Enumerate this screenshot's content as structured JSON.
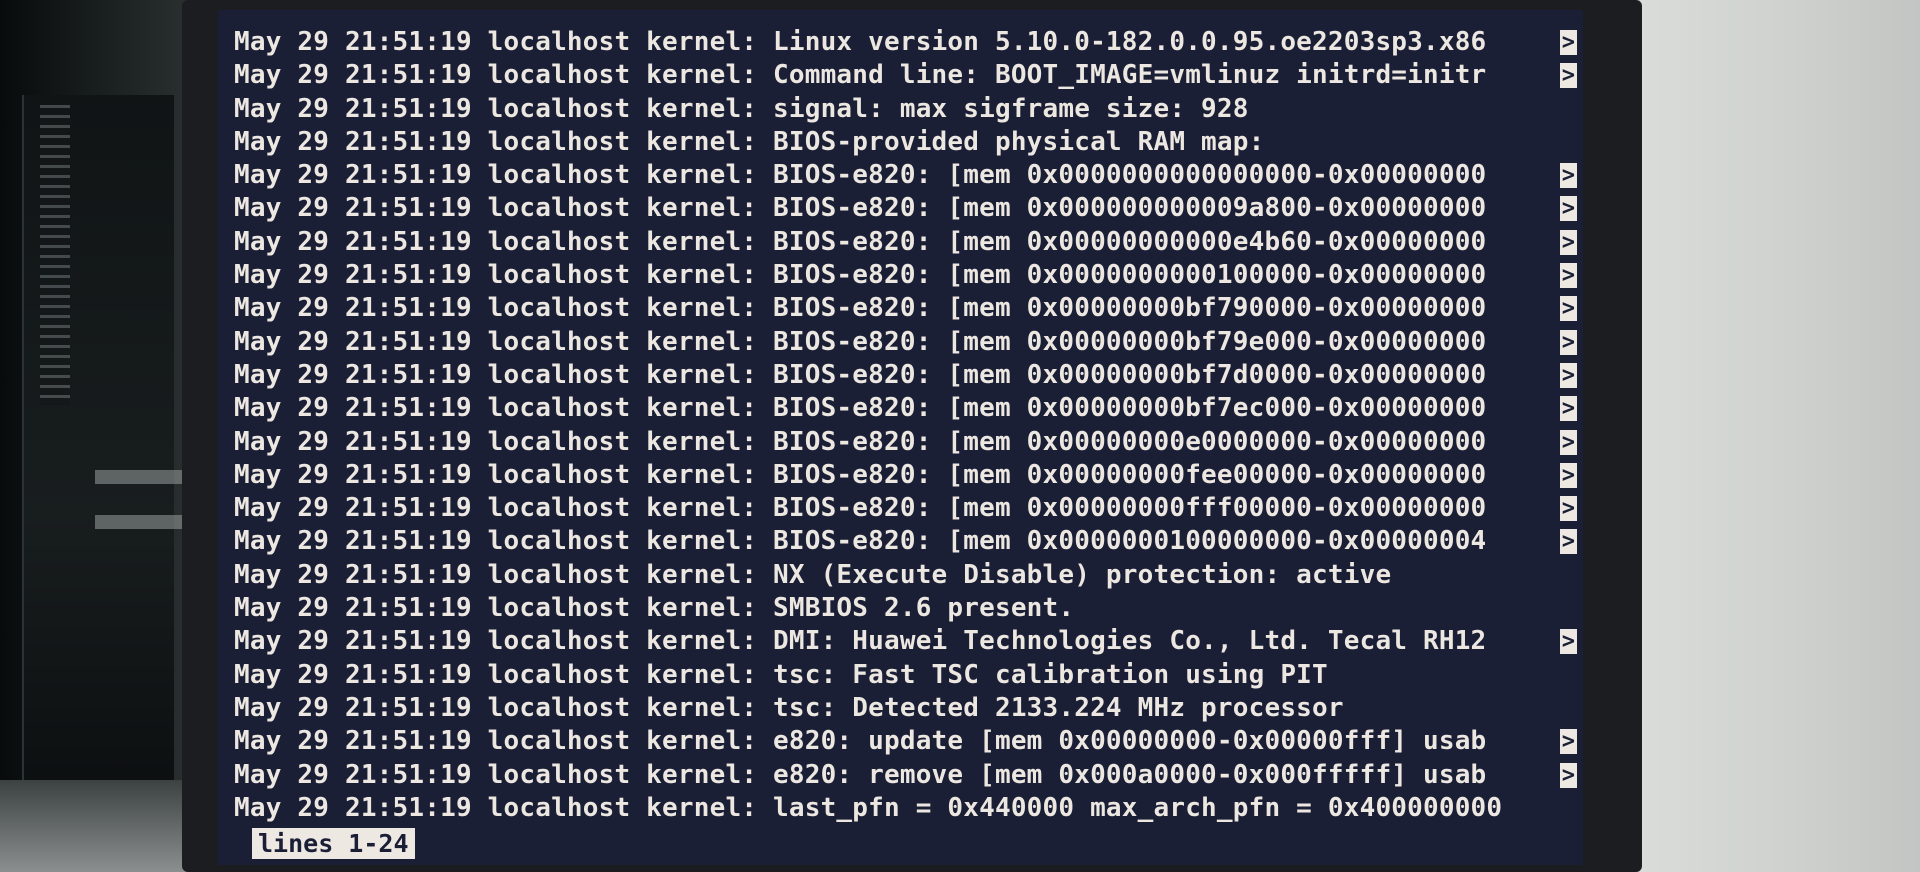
{
  "terminal": {
    "prefix": "May 29 21:51:19 localhost kernel: ",
    "lines": [
      {
        "msg": "Linux version 5.10.0-182.0.0.95.oe2203sp3.x86",
        "truncated": true
      },
      {
        "msg": "Command line: BOOT_IMAGE=vmlinuz initrd=initr",
        "truncated": true
      },
      {
        "msg": "signal: max sigframe size: 928",
        "truncated": false
      },
      {
        "msg": "BIOS-provided physical RAM map:",
        "truncated": false
      },
      {
        "msg": "BIOS-e820: [mem 0x0000000000000000-0x00000000",
        "truncated": true
      },
      {
        "msg": "BIOS-e820: [mem 0x000000000009a800-0x00000000",
        "truncated": true
      },
      {
        "msg": "BIOS-e820: [mem 0x00000000000e4b60-0x00000000",
        "truncated": true
      },
      {
        "msg": "BIOS-e820: [mem 0x0000000000100000-0x00000000",
        "truncated": true
      },
      {
        "msg": "BIOS-e820: [mem 0x00000000bf790000-0x00000000",
        "truncated": true
      },
      {
        "msg": "BIOS-e820: [mem 0x00000000bf79e000-0x00000000",
        "truncated": true
      },
      {
        "msg": "BIOS-e820: [mem 0x00000000bf7d0000-0x00000000",
        "truncated": true
      },
      {
        "msg": "BIOS-e820: [mem 0x00000000bf7ec000-0x00000000",
        "truncated": true
      },
      {
        "msg": "BIOS-e820: [mem 0x00000000e0000000-0x00000000",
        "truncated": true
      },
      {
        "msg": "BIOS-e820: [mem 0x00000000fee00000-0x00000000",
        "truncated": true
      },
      {
        "msg": "BIOS-e820: [mem 0x00000000fff00000-0x00000000",
        "truncated": true
      },
      {
        "msg": "BIOS-e820: [mem 0x0000000100000000-0x00000004",
        "truncated": true
      },
      {
        "msg": "NX (Execute Disable) protection: active",
        "truncated": false
      },
      {
        "msg": "SMBIOS 2.6 present.",
        "truncated": false
      },
      {
        "msg": "DMI: Huawei Technologies Co., Ltd. Tecal RH12",
        "truncated": true
      },
      {
        "msg": "tsc: Fast TSC calibration using PIT",
        "truncated": false
      },
      {
        "msg": "tsc: Detected 2133.224 MHz processor",
        "truncated": false
      },
      {
        "msg": "e820: update [mem 0x00000000-0x00000fff] usab",
        "truncated": true
      },
      {
        "msg": "e820: remove [mem 0x000a0000-0x000fffff] usab",
        "truncated": true
      },
      {
        "msg": "last_pfn = 0x440000 max_arch_pfn = 0x400000000",
        "truncated": false
      }
    ],
    "truncation_marker": ">",
    "status": "lines 1-24"
  },
  "colors": {
    "screen_bg": "#1b1f36",
    "text": "#ece7e1",
    "status_bg": "#ede8e2"
  }
}
